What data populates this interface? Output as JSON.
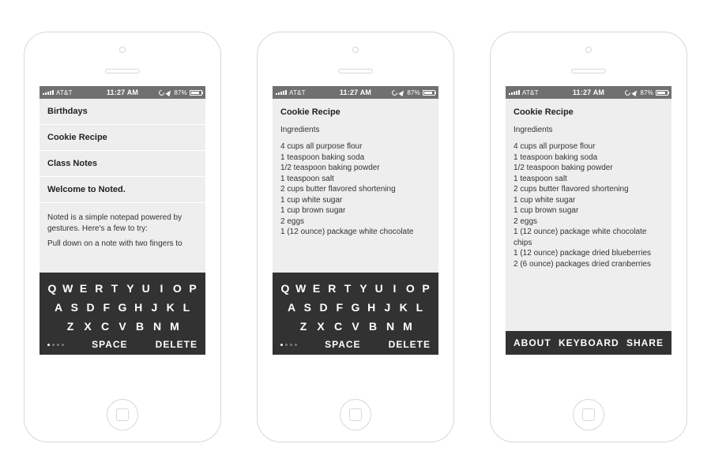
{
  "status": {
    "carrier": "AT&T",
    "time": "11:27 AM",
    "battery": "87%"
  },
  "screen1": {
    "list": [
      "Birthdays",
      "Cookie Recipe",
      "Class Notes",
      "Welcome to Noted."
    ],
    "welcome_line1": "Noted is a simple notepad powered by gestures. Here's a few to try:",
    "welcome_line2": "Pull down on a note with two fingers to"
  },
  "note": {
    "title": "Cookie Recipe",
    "section": "Ingredients",
    "ingredients": [
      "4 cups all purpose flour",
      "1 teaspoon baking soda",
      "1/2 teaspoon baking powder",
      "1 teaspoon salt",
      "2 cups butter flavored shortening",
      "1 cup white sugar",
      "1 cup brown sugar",
      "2 eggs",
      "1 (12 ounce) package white chocolate chips",
      "1 (12 ounce) package dried blueberries",
      "2 (6 ounce) packages dried cranberries"
    ],
    "visible_count_s2": 9,
    "truncated_last_s2": "1 (12 ounce) package white chocolate"
  },
  "keyboard": {
    "row1": [
      "Q",
      "W",
      "E",
      "R",
      "T",
      "Y",
      "U",
      "I",
      "O",
      "P"
    ],
    "row2": [
      "A",
      "S",
      "D",
      "F",
      "G",
      "H",
      "J",
      "K",
      "L"
    ],
    "row3": [
      "Z",
      "X",
      "C",
      "V",
      "B",
      "N",
      "M"
    ],
    "space": "SPACE",
    "delete": "DELETE"
  },
  "actionbar": {
    "about": "ABOUT",
    "keyboard": "KEYBOARD",
    "share": "SHARE"
  }
}
